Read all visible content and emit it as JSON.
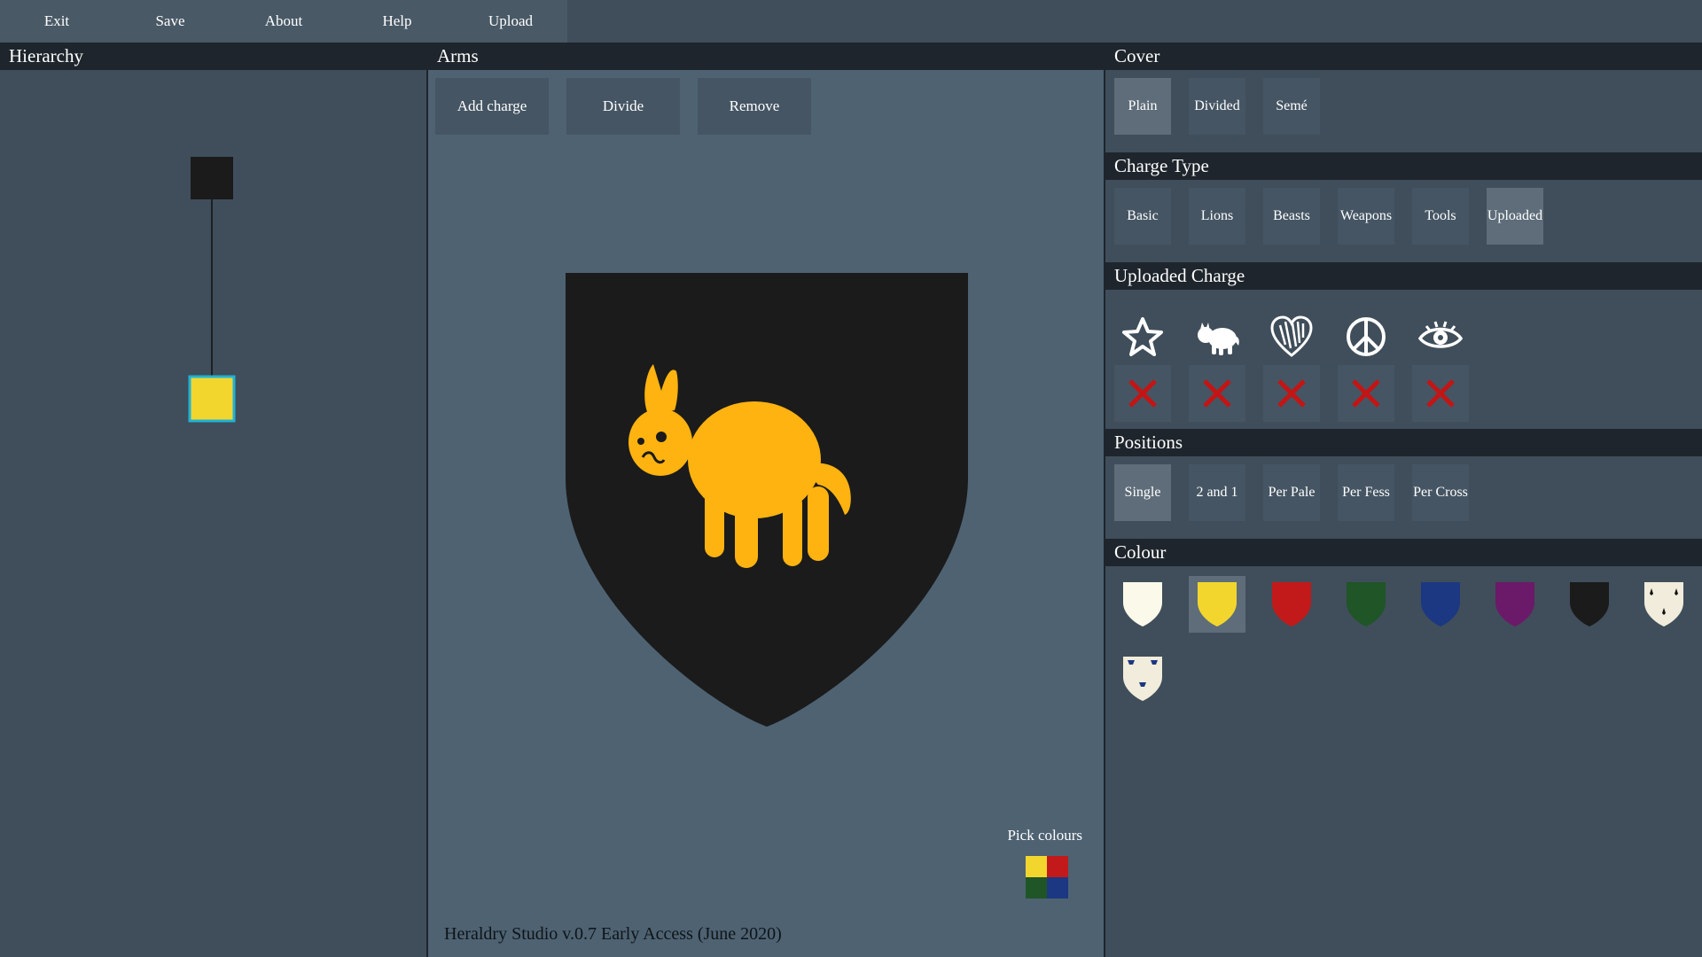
{
  "menu": [
    "Exit",
    "Save",
    "About",
    "Help",
    "Upload"
  ],
  "hierarchy": {
    "title": "Hierarchy"
  },
  "arms": {
    "title": "Arms",
    "toolbar": {
      "add_label": "Add charge",
      "divide_label": "Divide",
      "remove_label": "Remove"
    },
    "pick_colours_label": "Pick colours",
    "footer": "Heraldry Studio v.0.7 Early Access (June 2020)"
  },
  "cover": {
    "title": "Cover",
    "options": [
      "Plain",
      "Divided",
      "Semé"
    ],
    "selected": "Plain"
  },
  "charge_type": {
    "title": "Charge Type",
    "options": [
      "Basic",
      "Lions",
      "Beasts",
      "Weapons",
      "Tools",
      "Uploaded"
    ],
    "selected": "Uploaded"
  },
  "uploaded_charge": {
    "title": "Uploaded Charge",
    "icons": [
      "star-icon",
      "dog-icon",
      "heart-icon",
      "peace-icon",
      "eye-icon"
    ]
  },
  "positions": {
    "title": "Positions",
    "options": [
      "Single",
      "2 and 1",
      "Per Pale",
      "Per Fess",
      "Per Cross"
    ],
    "selected": "Single"
  },
  "colour": {
    "title": "Colour",
    "swatches": [
      "#fbf9ea",
      "#f2d62e",
      "#c21a1a",
      "#1f5527",
      "#1c3882",
      "#6a1a68",
      "#1b1b1b",
      "ermine",
      "vair"
    ],
    "selected": 1
  },
  "colors": {
    "field": "#1b1b1b",
    "charge": "#ffb310",
    "hierarchy_root": "#1b1b1b",
    "hierarchy_child": "#f2d62e",
    "selection": "#1fb3d6"
  }
}
